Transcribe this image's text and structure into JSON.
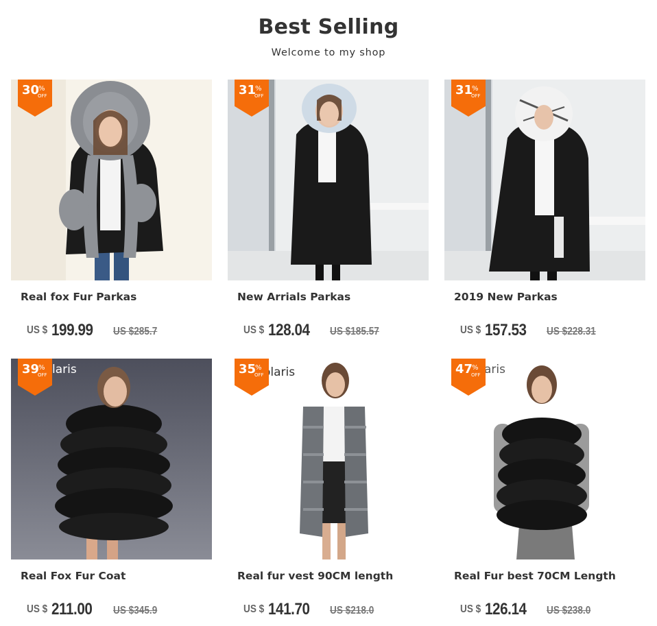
{
  "header": {
    "title": "Best Selling",
    "subtitle": "Welcome to my shop"
  },
  "colors": {
    "badge": "#f56d0a",
    "text": "#333333",
    "old_price": "#777777"
  },
  "products": [
    {
      "discount": "30",
      "percent_symbol": "%",
      "off_label": "OFF",
      "name": "Real fox Fur Parkas",
      "currency": "US $",
      "price": "199.99",
      "original_price": "US $285.7",
      "image_icon": "grey-fur-hood-parka-photo"
    },
    {
      "discount": "31",
      "percent_symbol": "%",
      "off_label": "OFF",
      "name": "New Arrials Parkas",
      "currency": "US $",
      "price": "128.04",
      "original_price": "US $185.57",
      "image_icon": "blue-fur-hood-parka-photo"
    },
    {
      "discount": "31",
      "percent_symbol": "%",
      "off_label": "OFF",
      "name": "2019 New Parkas",
      "currency": "US $",
      "price": "157.53",
      "original_price": "US $228.31",
      "image_icon": "white-fur-hood-parka-photo"
    },
    {
      "discount": "39",
      "percent_symbol": "%",
      "off_label": "OFF",
      "name": "Real Fox Fur Coat",
      "currency": "US $",
      "price": "211.00",
      "original_price": "US $345.9",
      "brand_text": "laris",
      "image_icon": "black-fur-coat-photo"
    },
    {
      "discount": "35",
      "percent_symbol": "%",
      "off_label": "OFF",
      "name": "Real fur vest 90CM length",
      "currency": "US $",
      "price": "141.70",
      "original_price": "US $218.0",
      "brand_text": "olaris",
      "image_icon": "grey-fur-vest-photo"
    },
    {
      "discount": "47",
      "percent_symbol": "%",
      "off_label": "OFF",
      "name": "Real Fur best 70CM Length",
      "currency": "US $",
      "price": "126.14",
      "original_price": "US $238.0",
      "brand_text": "aris",
      "image_icon": "black-fur-vest-photo"
    }
  ]
}
